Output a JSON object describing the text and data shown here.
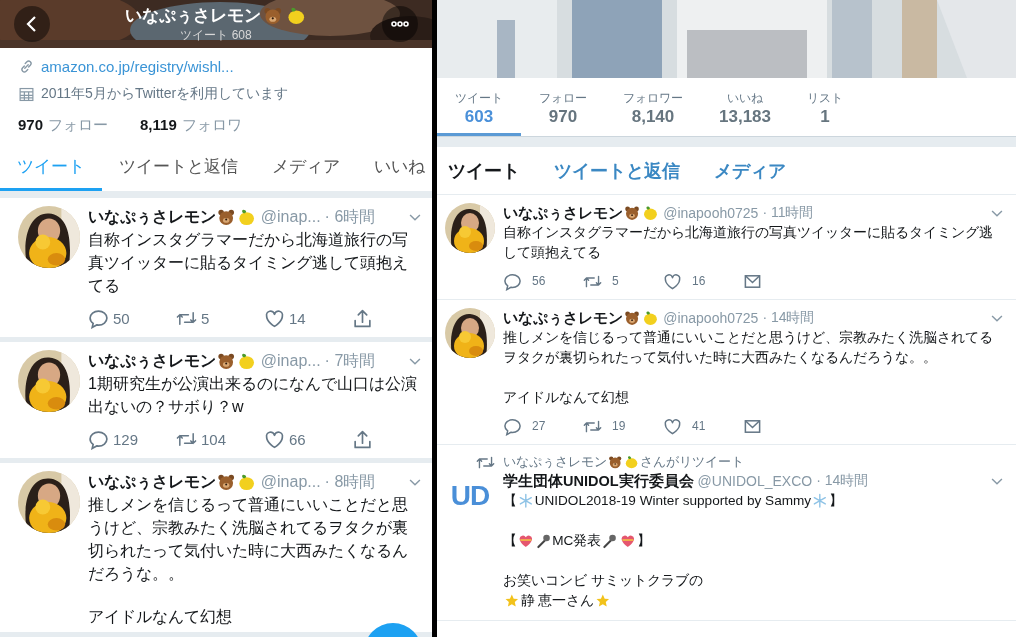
{
  "mobile": {
    "header": {
      "title": [
        {
          "text": "いなぷぅさレモン"
        },
        {
          "kind": "bear"
        },
        {
          "kind": "lemon"
        }
      ],
      "subtitle": "ツイート 608"
    },
    "profile": {
      "link": "amazon.co.jp/registry/wishl...",
      "joined": "2011年5月からTwitterを利用しています",
      "stats": [
        {
          "value": "970",
          "label": "フォロー"
        },
        {
          "value": "8,119",
          "label": "フォロワ"
        }
      ]
    },
    "tabs": [
      {
        "label": "ツイート",
        "selected": true
      },
      {
        "label": "ツイートと返信",
        "selected": false
      },
      {
        "label": "メディア",
        "selected": false
      },
      {
        "label": "いいね",
        "selected": false
      }
    ],
    "tweets": [
      {
        "avatar": {
          "kind": "picture"
        },
        "name": [
          {
            "text": "いなぷぅさレモン"
          },
          {
            "kind": "bear"
          },
          {
            "kind": "lemon"
          }
        ],
        "handle": "@inap...",
        "time": "· 6時間",
        "body": [
          [
            "自称インスタグラマーだから北海道旅行の写真ツイッターに貼るタイミング逃して頭抱えてる"
          ]
        ],
        "actions": [
          {
            "kind": "reply",
            "count": "50"
          },
          {
            "kind": "retweet",
            "count": "5"
          },
          {
            "kind": "like",
            "count": "14"
          },
          {
            "kind": "share"
          }
        ]
      },
      {
        "avatar": {
          "kind": "picture"
        },
        "name": [
          {
            "text": "いなぷぅさレモン"
          },
          {
            "kind": "bear"
          },
          {
            "kind": "lemon"
          }
        ],
        "handle": "@inap...",
        "time": "· 7時間",
        "body": [
          [
            "1期研究生が公演出来るのになんで山口は公演出ないの？サボり？w"
          ]
        ],
        "actions": [
          {
            "kind": "reply",
            "count": "129"
          },
          {
            "kind": "retweet",
            "count": "104"
          },
          {
            "kind": "like",
            "count": "66"
          },
          {
            "kind": "share"
          }
        ]
      },
      {
        "avatar": {
          "kind": "picture"
        },
        "name": [
          {
            "text": "いなぷぅさレモン"
          },
          {
            "kind": "bear"
          },
          {
            "kind": "lemon"
          }
        ],
        "handle": "@inap...",
        "time": "· 8時間",
        "body": [
          [
            "推しメンを信じるって普通にいいことだと思うけど、宗教みたく洗脳されてるヲタクが裏切られたって気付いた時に大西みたくなるんだろうな。。"
          ],
          [
            "アイドルなんて幻想"
          ]
        ]
      }
    ]
  },
  "desktop": {
    "stats": [
      {
        "label": "ツイート",
        "value": "603",
        "selected": true
      },
      {
        "label": "フォロー",
        "value": "970",
        "selected": false
      },
      {
        "label": "フォロワー",
        "value": "8,140",
        "selected": false
      },
      {
        "label": "いいね",
        "value": "13,183",
        "selected": false
      },
      {
        "label": "リスト",
        "value": "1",
        "selected": false
      }
    ],
    "tabs": [
      {
        "label": "ツイート",
        "selected": true
      },
      {
        "label": "ツイートと返信",
        "selected": false
      },
      {
        "label": "メディア",
        "selected": false
      }
    ],
    "tweets": [
      {
        "avatar": {
          "kind": "picture"
        },
        "name": [
          {
            "text": "いなぷぅさレモン"
          },
          {
            "kind": "bear"
          },
          {
            "kind": "lemon"
          }
        ],
        "handle": "@inapooh0725",
        "time": "· 11時間",
        "body": [
          [
            "自称インスタグラマーだから北海道旅行の写真ツイッターに貼るタイミング逃して頭抱えてる"
          ]
        ],
        "actions": [
          {
            "kind": "reply",
            "count": "56"
          },
          {
            "kind": "retweet",
            "count": "5"
          },
          {
            "kind": "like",
            "count": "16"
          },
          {
            "kind": "message"
          }
        ]
      },
      {
        "avatar": {
          "kind": "picture"
        },
        "name": [
          {
            "text": "いなぷぅさレモン"
          },
          {
            "kind": "bear"
          },
          {
            "kind": "lemon"
          }
        ],
        "handle": "@inapooh0725",
        "time": "· 14時間",
        "body": [
          [
            "推しメンを信じるって普通にいいことだと思うけど、宗教みたく洗脳されてるヲタクが裏切られたって気付いた時に大西みたくなるんだろうな。。"
          ],
          [
            "アイドルなんて幻想"
          ]
        ],
        "actions": [
          {
            "kind": "reply",
            "count": "27"
          },
          {
            "kind": "retweet",
            "count": "19"
          },
          {
            "kind": "like",
            "count": "41"
          },
          {
            "kind": "message"
          }
        ]
      },
      {
        "retweeted_by": [
          {
            "text": "いなぷぅさレモン"
          },
          {
            "kind": "bear"
          },
          {
            "kind": "lemon"
          },
          {
            "text": "さんがリツイート"
          }
        ],
        "avatar": {
          "kind": "logo",
          "text": "UD"
        },
        "name": [
          {
            "text": "学生団体UNIDOL実行委員会"
          }
        ],
        "handle": "@UNIDOL_EXCO",
        "time": "· 14時間",
        "body": [
          [
            [
              {
                "text": "【"
              },
              {
                "kind": "snowflake"
              },
              {
                "text": "UNIDOL2018-19 Winter supported by Sammy"
              },
              {
                "kind": "snowflake"
              },
              {
                "text": "】"
              }
            ]
          ],
          [
            [
              {
                "text": "【"
              },
              {
                "kind": "heart"
              },
              {
                "kind": "mic"
              },
              {
                "text": "MC発表"
              },
              {
                "kind": "mic"
              },
              {
                "kind": "heart"
              },
              {
                "text": "】"
              }
            ]
          ],
          [
            "お笑いコンビ サミットクラブの",
            [
              {
                "kind": "star"
              },
              {
                "text": "静 恵一さん"
              },
              {
                "kind": "star"
              }
            ]
          ]
        ]
      }
    ]
  }
}
